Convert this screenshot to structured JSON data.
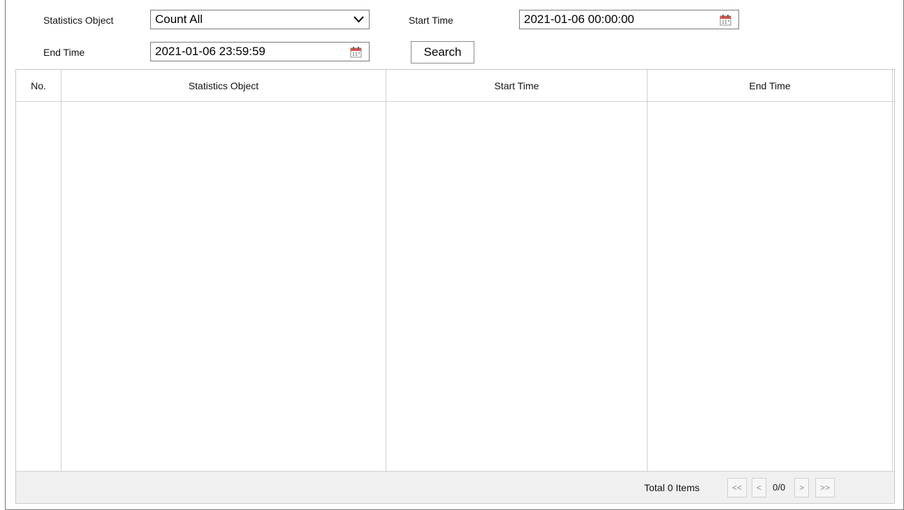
{
  "filters": {
    "statistics_object_label": "Statistics Object",
    "statistics_object_value": "Count All",
    "start_time_label": "Start Time",
    "start_time_value": "2021-01-06 00:00:00",
    "end_time_label": "End Time",
    "end_time_value": "2021-01-06 23:59:59",
    "search_label": "Search"
  },
  "table": {
    "columns": [
      "No.",
      "Statistics Object",
      "Start Time",
      "End Time"
    ],
    "rows": []
  },
  "pagination": {
    "total_text": "Total 0 Items",
    "first_label": "<<",
    "prev_label": "<",
    "page_info": "0/0",
    "next_label": ">",
    "last_label": ">>"
  },
  "icons": {
    "dropdown": "chevron-down-icon",
    "calendar": "calendar-icon"
  },
  "colors": {
    "calendar_accent": "#d9534f",
    "footer_bg": "#f0f0f0",
    "border": "#7a7a7a"
  }
}
